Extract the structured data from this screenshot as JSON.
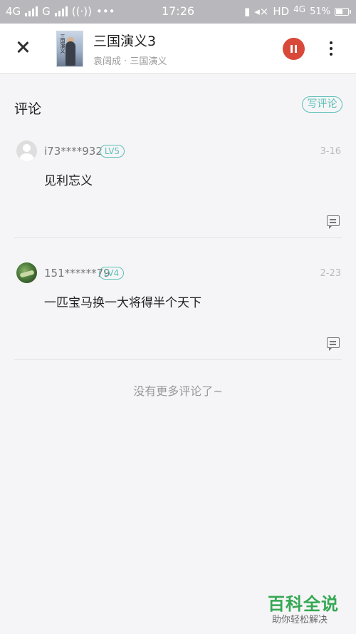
{
  "status_bar": {
    "network1": "4G",
    "network2": "G",
    "time": "17:26",
    "hd": "HD",
    "network3": "4G",
    "battery": "51%"
  },
  "header": {
    "title": "三国演义3",
    "subtitle": "袁阔成 · 三国演义",
    "cover_text": "三国演义"
  },
  "section": {
    "title": "评论",
    "write_label": "写评论"
  },
  "comments": [
    {
      "username": "i73****932",
      "level": "LV5",
      "date": "3-16",
      "text": "见利忘义"
    },
    {
      "username": "151******79",
      "level": "LV4",
      "date": "2-23",
      "text": "一匹宝马换一大将得半个天下"
    }
  ],
  "no_more": "没有更多评论了~",
  "watermark": {
    "title": "百科全说",
    "subtitle": "助你轻松解决"
  },
  "colors": {
    "accent": "#5ec0b8",
    "pause": "#d9493a",
    "status_bar": "#b8b8bc"
  }
}
